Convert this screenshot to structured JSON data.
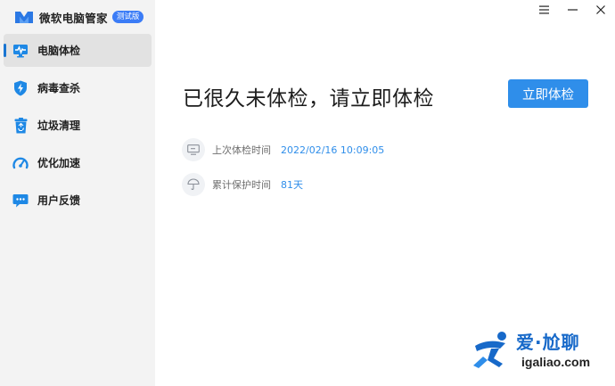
{
  "app": {
    "name": "微软电脑管家",
    "badge": "测试版"
  },
  "window_controls": {
    "menu_icon": "hamburger-icon",
    "minimize_icon": "minimize-icon",
    "close_icon": "close-icon"
  },
  "sidebar": {
    "items": [
      {
        "label": "电脑体检",
        "icon": "monitor-pulse-icon",
        "active": true
      },
      {
        "label": "病毒查杀",
        "icon": "shield-bolt-icon",
        "active": false
      },
      {
        "label": "垃圾清理",
        "icon": "recycle-bin-icon",
        "active": false
      },
      {
        "label": "优化加速",
        "icon": "speedometer-icon",
        "active": false
      },
      {
        "label": "用户反馈",
        "icon": "chat-bubble-icon",
        "active": false
      }
    ]
  },
  "main": {
    "headline": "已很久未体检，请立即体检",
    "cta_label": "立即体检",
    "last_check": {
      "label": "上次体检时间",
      "value": "2022/02/16 10:09:05",
      "icon": "monitor-icon"
    },
    "protect_time": {
      "label": "累计保护时间",
      "value": "81天",
      "icon": "umbrella-icon"
    }
  },
  "watermark": {
    "title": "爱·尬聊",
    "url": "igaliao.com"
  },
  "colors": {
    "accent": "#2f8eea",
    "sidebar_bg": "#f3f3f3",
    "active_item_bg": "#e2e2e2",
    "active_indicator": "#1975d2",
    "icon_blue": "#1e88e5"
  }
}
